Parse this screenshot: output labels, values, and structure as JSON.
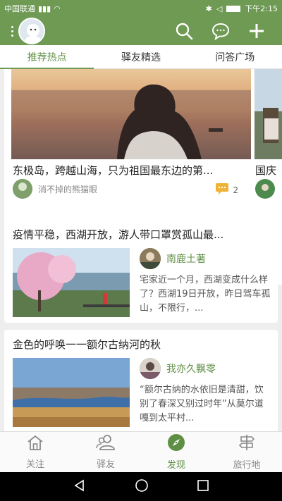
{
  "status": {
    "carrier": "中国联通",
    "time": "下午2:15"
  },
  "tabs": [
    {
      "label": "推荐热点",
      "active": true
    },
    {
      "label": "驿友精选",
      "active": false
    },
    {
      "label": "问答广场",
      "active": false
    }
  ],
  "feed": [
    {
      "title": "东极岛，跨越山海，只为祖国最东边的第...",
      "author": "消不掉的熊猫眼",
      "comments": "2"
    },
    {
      "title": "疫情平稳，西湖开放，游人带口罩赏孤山最...",
      "author": "南鹿土著",
      "excerpt": "宅家近一个月，西湖变成什么样了？西湖19日开放，昨日驾车孤山，不限行，..."
    },
    {
      "title": "金色的呼唤一一额尔古纳河的秋",
      "author": "我亦久飘零",
      "excerpt": "“额尔古纳的水依旧是清甜，饮别了春深又别过时年”从莫尔道嘎到太平村..."
    }
  ],
  "peek": {
    "title": "国庆"
  },
  "bottom_nav": [
    {
      "label": "关注",
      "icon": "home-icon",
      "active": false
    },
    {
      "label": "驿友",
      "icon": "friends-icon",
      "active": false
    },
    {
      "label": "发现",
      "icon": "compass-icon",
      "active": true
    },
    {
      "label": "旅行地",
      "icon": "signpost-icon",
      "active": false
    }
  ],
  "colors": {
    "brand": "#6e9a53",
    "active": "#5f8f45"
  }
}
